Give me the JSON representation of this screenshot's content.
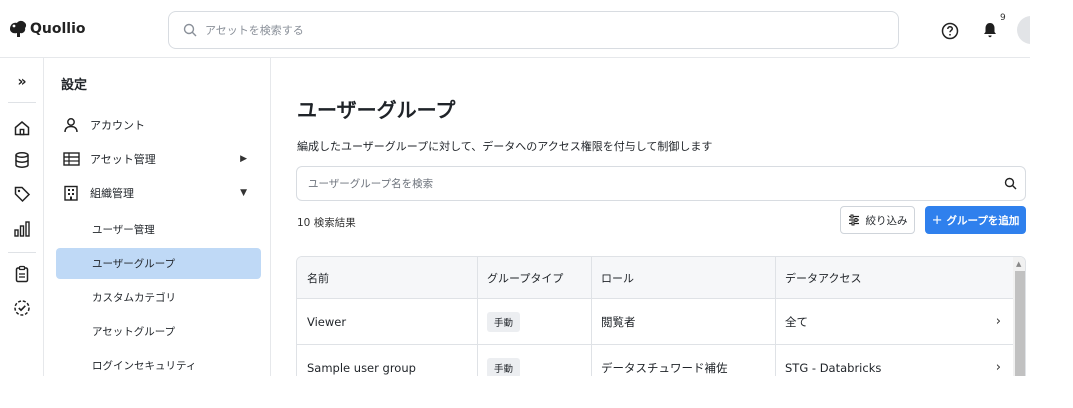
{
  "app": {
    "logo_text": "Quollio"
  },
  "header": {
    "search_placeholder": "アセットを検索する",
    "notification_count": "9"
  },
  "rail": {
    "icons": [
      "expand-icon",
      "home-icon",
      "database-icon",
      "tag-icon",
      "chart-icon",
      "clipboard-icon",
      "check-circle-icon"
    ]
  },
  "sidebar": {
    "title": "設定",
    "items": [
      {
        "label": "アカウント",
        "icon": "person-icon"
      },
      {
        "label": "アセット管理",
        "icon": "table-icon",
        "arrow": "▶"
      },
      {
        "label": "組織管理",
        "icon": "building-icon",
        "arrow": "▼"
      }
    ],
    "sub_items": [
      {
        "label": "ユーザー管理"
      },
      {
        "label": "ユーザーグループ",
        "active": true
      },
      {
        "label": "カスタムカテゴリ"
      },
      {
        "label": "アセットグループ"
      },
      {
        "label": "ログインセキュリティ"
      }
    ]
  },
  "main": {
    "title": "ユーザーグループ",
    "description": "編成したユーザーグループに対して、データへのアクセス権限を付与して制御します",
    "search_placeholder": "ユーザーグループ名を検索",
    "result_count": "10 検索結果",
    "filter_label": "絞り込み",
    "add_label": "グループを追加",
    "table": {
      "columns": [
        "名前",
        "グループタイプ",
        "ロール",
        "データアクセス"
      ],
      "rows": [
        {
          "name": "Viewer",
          "type": "手動",
          "role": "閲覧者",
          "access": "全て"
        },
        {
          "name": "Sample user group",
          "type": "手動",
          "role": "データスチュワード補佐",
          "access": "STG - Databricks"
        }
      ]
    }
  },
  "colors": {
    "accent": "#2f80ed",
    "active_item_bg": "#bfd9f6"
  }
}
